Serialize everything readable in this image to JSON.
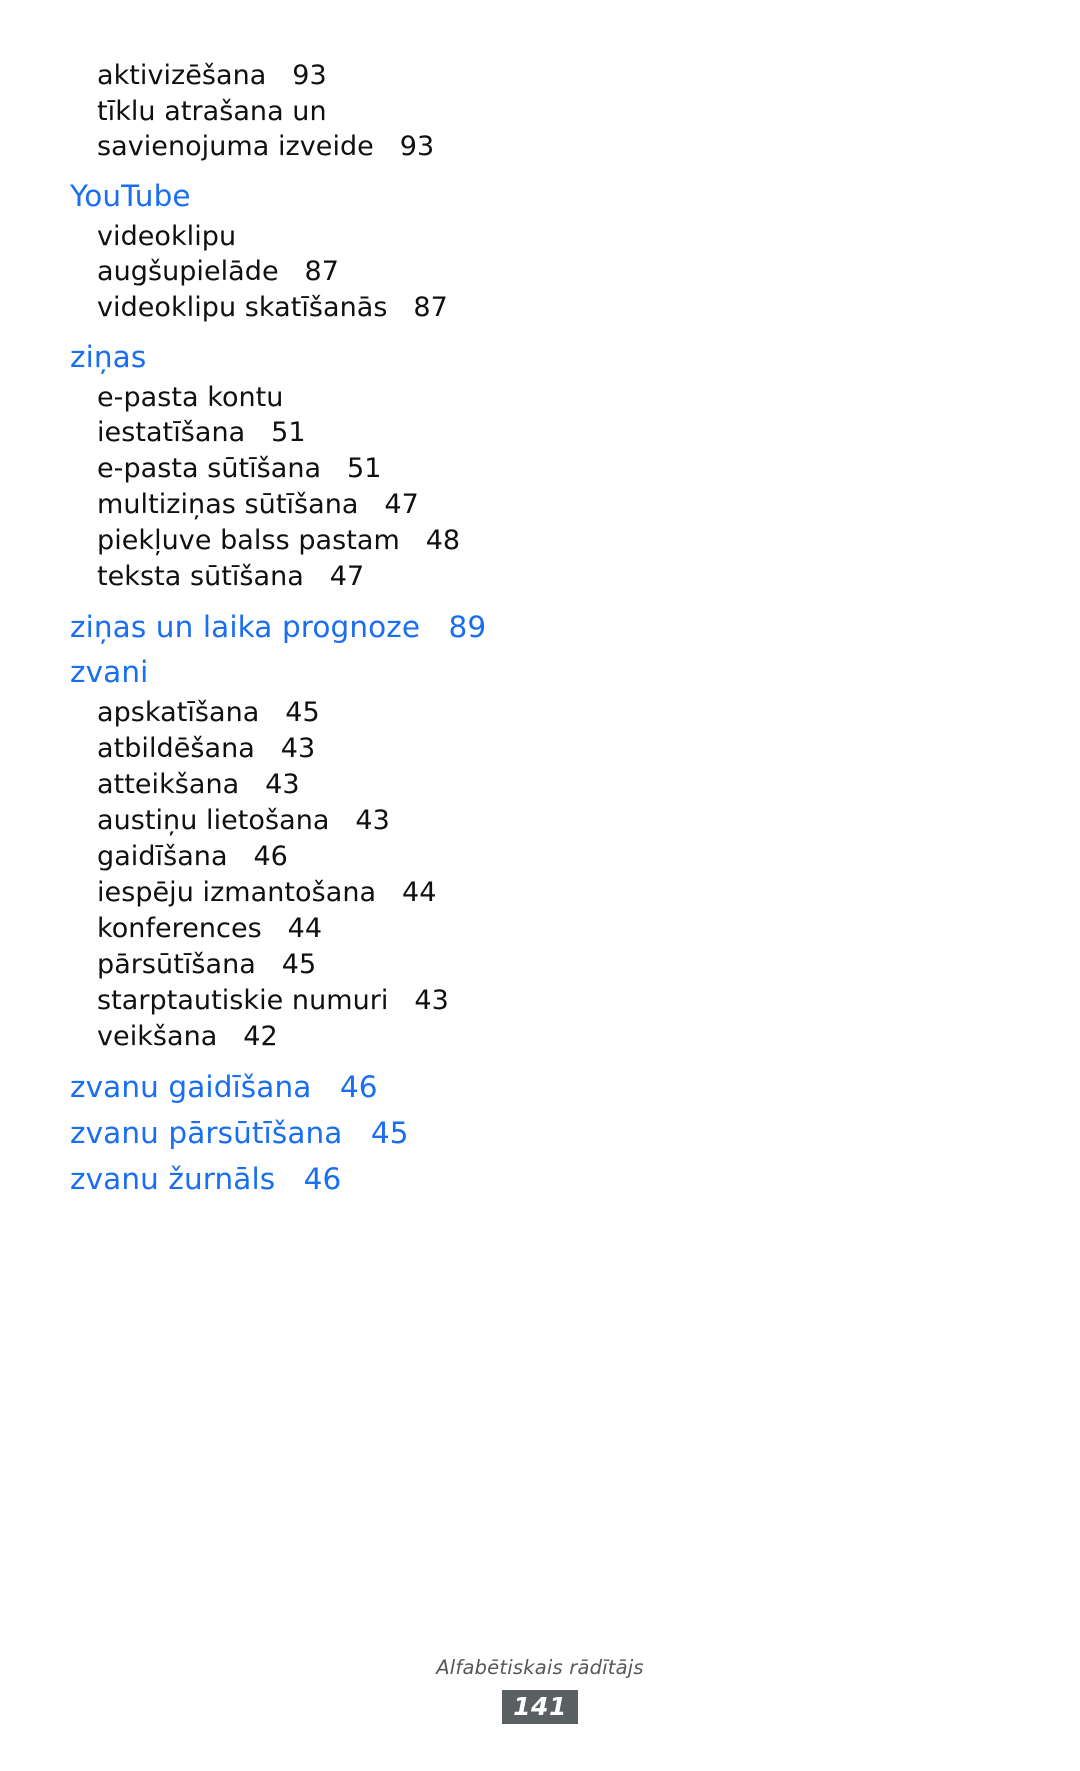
{
  "document": {
    "type": "index-page",
    "language": "lv",
    "heading_color": "#1a6ef0",
    "body_color": "#101010",
    "footer_caption_color": "#575757",
    "footer_badge_bg": "#5a5f61"
  },
  "index": {
    "groups": [
      {
        "heading": null,
        "entries": [
          {
            "label": "aktivizēšana",
            "page": "93",
            "lines": [
              "aktivizēšana   93"
            ]
          },
          {
            "label": "tīklu atrašana un savienojuma izveide",
            "page": "93",
            "lines": [
              "tīklu atrašana un",
              "savienojuma izveide   93"
            ]
          }
        ]
      },
      {
        "heading": "YouTube",
        "heading_page": null,
        "entries": [
          {
            "label": "videoklipu augšupielāde",
            "page": "87",
            "lines": [
              "videoklipu",
              "augšupielāde   87"
            ]
          },
          {
            "label": "videoklipu skatīšanās",
            "page": "87",
            "lines": [
              "videoklipu skatīšanās   87"
            ]
          }
        ]
      },
      {
        "heading": "ziņas",
        "heading_page": null,
        "entries": [
          {
            "label": "e-pasta kontu iestatīšana",
            "page": "51",
            "lines": [
              "e-pasta kontu",
              "iestatīšana   51"
            ]
          },
          {
            "label": "e-pasta sūtīšana",
            "page": "51",
            "lines": [
              "e-pasta sūtīšana   51"
            ]
          },
          {
            "label": "multiziņas sūtīšana",
            "page": "47",
            "lines": [
              "multiziņas sūtīšana   47"
            ]
          },
          {
            "label": "piekļuve balss pastam",
            "page": "48",
            "lines": [
              "piekļuve balss pastam   48"
            ]
          },
          {
            "label": "teksta sūtīšana",
            "page": "47",
            "lines": [
              "teksta sūtīšana   47"
            ]
          }
        ]
      },
      {
        "heading": "ziņas un laika prognoze",
        "heading_page": "89",
        "heading_line": "ziņas un laika prognoze   89",
        "entries": []
      },
      {
        "heading": "zvani",
        "heading_page": null,
        "entries": [
          {
            "label": "apskatīšana",
            "page": "45",
            "lines": [
              "apskatīšana   45"
            ]
          },
          {
            "label": "atbildēšana",
            "page": "43",
            "lines": [
              "atbildēšana   43"
            ]
          },
          {
            "label": "atteikšana",
            "page": "43",
            "lines": [
              "atteikšana   43"
            ]
          },
          {
            "label": "austiņu lietošana",
            "page": "43",
            "lines": [
              "austiņu lietošana   43"
            ]
          },
          {
            "label": "gaidīšana",
            "page": "46",
            "lines": [
              "gaidīšana   46"
            ]
          },
          {
            "label": "iespēju izmantošana",
            "page": "44",
            "lines": [
              "iespēju izmantošana   44"
            ]
          },
          {
            "label": "konferences",
            "page": "44",
            "lines": [
              "konferences   44"
            ]
          },
          {
            "label": "pārsūtīšana",
            "page": "45",
            "lines": [
              "pārsūtīšana   45"
            ]
          },
          {
            "label": "starptautiskie numuri",
            "page": "43",
            "lines": [
              "starptautiskie numuri   43"
            ]
          },
          {
            "label": "veikšana",
            "page": "42",
            "lines": [
              "veikšana   42"
            ]
          }
        ]
      },
      {
        "heading": "zvanu gaidīšana",
        "heading_page": "46",
        "heading_line": "zvanu gaidīšana   46",
        "entries": []
      },
      {
        "heading": "zvanu pārsūtīšana",
        "heading_page": "45",
        "heading_line": "zvanu pārsūtīšana   45",
        "entries": []
      },
      {
        "heading": "zvanu žurnāls",
        "heading_page": "46",
        "heading_line": "zvanu žurnāls   46",
        "entries": []
      }
    ],
    "lines": {
      "l01": "aktivizēšana   93",
      "l02": "tīklu atrašana un",
      "l03": "savienojuma izveide   93",
      "h_youtube": "YouTube",
      "l04": "videoklipu",
      "l05": "augšupielāde   87",
      "l06": "videoklipu skatīšanās   87",
      "h_zinas": "ziņas",
      "l07": "e-pasta kontu",
      "l08": "iestatīšana   51",
      "l09": "e-pasta sūtīšana   51",
      "l10": "multiziņas sūtīšana   47",
      "l11": "piekļuve balss pastam   48",
      "l12": "teksta sūtīšana   47",
      "h_zinas_laika": "ziņas un laika prognoze   89",
      "h_zvani": "zvani",
      "l13": "apskatīšana   45",
      "l14": "atbildēšana   43",
      "l15": "atteikšana   43",
      "l16": "austiņu lietošana   43",
      "l17": "gaidīšana   46",
      "l18": "iespēju izmantošana   44",
      "l19": "konferences   44",
      "l20": "pārsūtīšana   45",
      "l21": "starptautiskie numuri   43",
      "l22": "veikšana   42",
      "h_zvanu_gaidisana": "zvanu gaidīšana   46",
      "h_zvanu_parsutisana": "zvanu pārsūtīšana   45",
      "h_zvanu_zurnals": "zvanu žurnāls   46"
    }
  },
  "footer": {
    "caption": "Alfabētiskais rādītājs",
    "page_number": "141"
  }
}
